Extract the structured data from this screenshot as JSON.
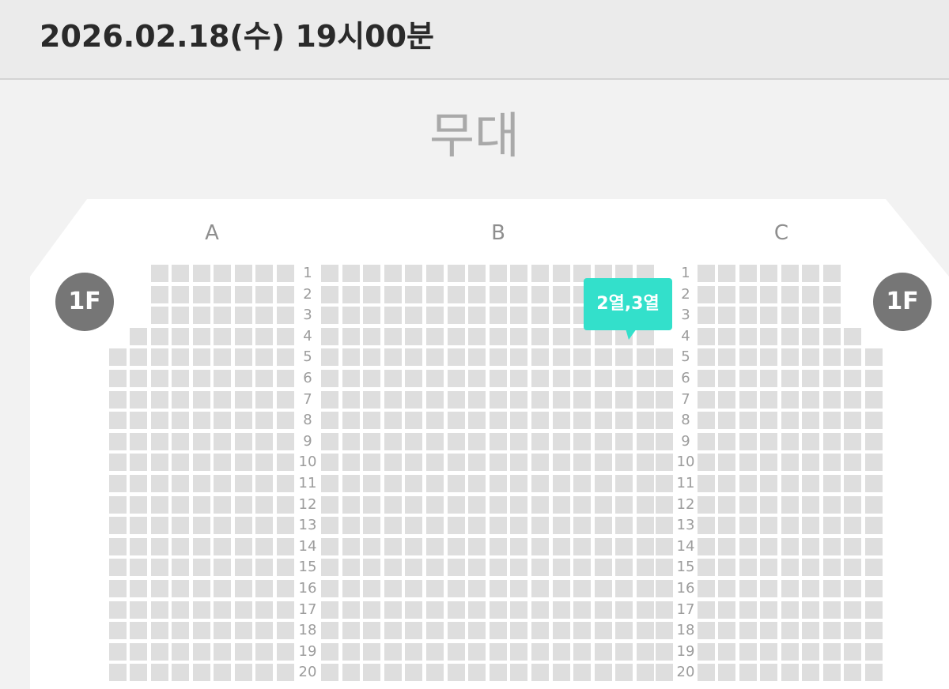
{
  "header": {
    "title": "2026.02.18(수) 19시00분"
  },
  "stage": {
    "label": "무대"
  },
  "sections": [
    {
      "key": "A",
      "label": "A"
    },
    {
      "key": "B",
      "label": "B"
    },
    {
      "key": "C",
      "label": "C"
    }
  ],
  "floor": {
    "label": "1F"
  },
  "tooltip": {
    "label": "2열,3열"
  },
  "row_labels": [
    "1",
    "2",
    "3",
    "4",
    "5",
    "6",
    "7",
    "8",
    "9",
    "10",
    "11",
    "12",
    "13",
    "14",
    "15",
    "16",
    "17",
    "18",
    "19",
    "20"
  ],
  "colors": {
    "seat": "#dedede",
    "tooltip": "#33e0cb",
    "badge": "#767676"
  }
}
